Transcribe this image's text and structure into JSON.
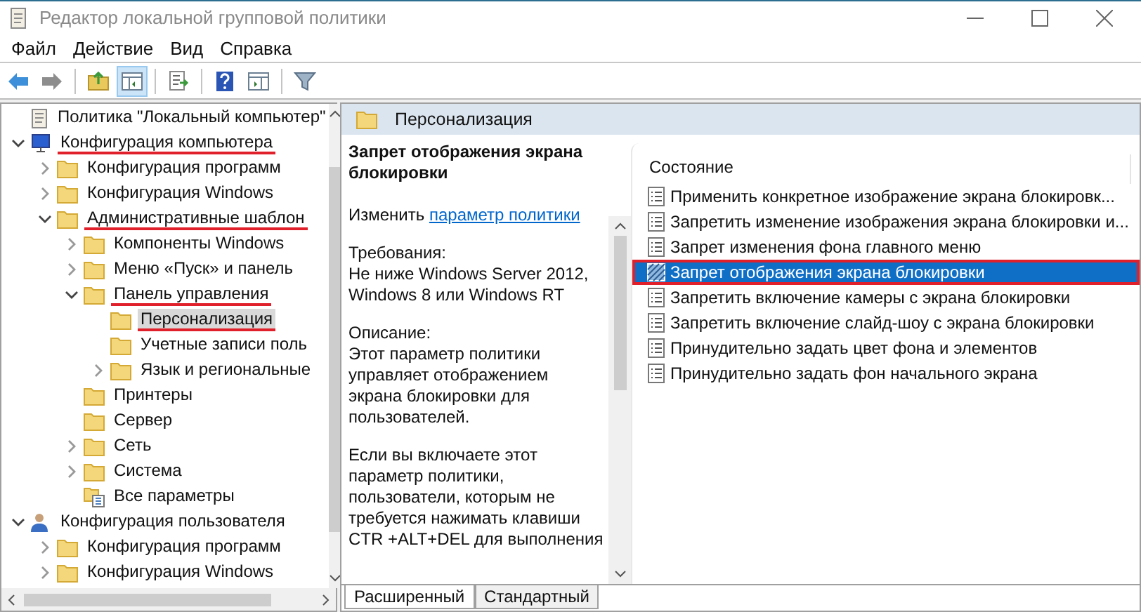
{
  "window": {
    "title": "Редактор локальной групповой политики"
  },
  "menu": [
    "Файл",
    "Действие",
    "Вид",
    "Справка"
  ],
  "toolbar": [
    [
      {
        "kind": "back",
        "pressed": false
      },
      {
        "kind": "forward",
        "pressed": false
      }
    ],
    [
      {
        "kind": "up",
        "pressed": false
      },
      {
        "kind": "tree-toggle",
        "pressed": true
      }
    ],
    [
      {
        "kind": "export",
        "pressed": false
      }
    ],
    [
      {
        "kind": "help",
        "pressed": false
      },
      {
        "kind": "properties",
        "pressed": false
      }
    ],
    [
      {
        "kind": "filter",
        "pressed": false
      }
    ]
  ],
  "tree": [
    {
      "label": "Политика \"Локальный компьютер\"",
      "kind": "policy",
      "selected": false,
      "underlined": false,
      "children": [
        {
          "label": "Конфигурация компьютера",
          "kind": "computer",
          "expanded": true,
          "selected": false,
          "underlined": true,
          "children": [
            {
              "label": "Конфигурация программ",
              "kind": "folder",
              "expanded": false,
              "selected": false,
              "underlined": false
            },
            {
              "label": "Конфигурация Windows",
              "kind": "folder",
              "expanded": false,
              "selected": false,
              "underlined": false
            },
            {
              "label": "Административные шаблон",
              "kind": "folder",
              "expanded": true,
              "selected": false,
              "underlined": true,
              "children": [
                {
                  "label": "Компоненты Windows",
                  "kind": "folder",
                  "expanded": false,
                  "selected": false,
                  "underlined": false
                },
                {
                  "label": "Меню «Пуск» и панель",
                  "kind": "folder",
                  "expanded": false,
                  "selected": false,
                  "underlined": false
                },
                {
                  "label": "Панель управления",
                  "kind": "folder",
                  "expanded": true,
                  "selected": false,
                  "underlined": true,
                  "children": [
                    {
                      "label": "Персонализация",
                      "kind": "folder",
                      "selected": true,
                      "underlined": true
                    },
                    {
                      "label": "Учетные записи поль",
                      "kind": "folder",
                      "selected": false,
                      "underlined": false
                    },
                    {
                      "label": "Язык и региональные",
                      "kind": "folder",
                      "expanded": false,
                      "selected": false,
                      "underlined": false
                    }
                  ]
                },
                {
                  "label": "Принтеры",
                  "kind": "folder",
                  "selected": false,
                  "underlined": false
                },
                {
                  "label": "Сервер",
                  "kind": "folder",
                  "selected": false,
                  "underlined": false
                },
                {
                  "label": "Сеть",
                  "kind": "folder",
                  "expanded": false,
                  "selected": false,
                  "underlined": false
                },
                {
                  "label": "Система",
                  "kind": "folder",
                  "expanded": false,
                  "selected": false,
                  "underlined": false
                },
                {
                  "label": "Все параметры",
                  "kind": "all-settings",
                  "selected": false,
                  "underlined": false
                }
              ]
            }
          ]
        },
        {
          "label": "Конфигурация пользователя",
          "kind": "user",
          "expanded": true,
          "selected": false,
          "underlined": false,
          "children": [
            {
              "label": "Конфигурация программ",
              "kind": "folder",
              "expanded": false,
              "selected": false,
              "underlined": false
            },
            {
              "label": "Конфигурация Windows",
              "kind": "folder",
              "expanded": false,
              "selected": false,
              "underlined": false
            }
          ]
        }
      ]
    }
  ],
  "details": {
    "header": "Персонализация",
    "title": "Запрет отображения экрана блокировки",
    "edit_prefix": "Изменить",
    "edit_link": "параметр политики",
    "paragraphs": [
      [
        "Требования:",
        "Не ниже Windows Server 2012,",
        "Windows 8 или Windows RT"
      ],
      [
        "Описание:",
        "Этот параметр политики",
        "управляет отображением",
        "экрана блокировки для",
        "пользователей."
      ],
      [
        "Если вы включаете этот",
        "параметр политики,",
        "пользователи, которым не",
        "требуется нажимать клавиши",
        "CTR +ALT+DEL для выполнения"
      ]
    ]
  },
  "settings": {
    "column": "Состояние",
    "items": [
      {
        "label": "Применить конкретное изображение экрана блокировк...",
        "selected": false,
        "outlined": false
      },
      {
        "label": "Запретить изменение изображения экрана блокировки и...",
        "selected": false,
        "outlined": false
      },
      {
        "label": "Запрет изменения фона главного меню",
        "selected": false,
        "outlined": false
      },
      {
        "label": "Запрет отображения экрана блокировки",
        "selected": true,
        "outlined": true
      },
      {
        "label": "Запретить включение камеры с экрана блокировки",
        "selected": false,
        "outlined": false
      },
      {
        "label": "Запретить включение слайд-шоу с экрана блокировки",
        "selected": false,
        "outlined": false
      },
      {
        "label": "Принудительно задать цвет фона и элементов",
        "selected": false,
        "outlined": false
      },
      {
        "label": "Принудительно задать фон начального экрана",
        "selected": false,
        "outlined": false
      }
    ]
  },
  "tabs": [
    {
      "label": "Расширенный",
      "selected": true
    },
    {
      "label": "Стандартный",
      "selected": false
    }
  ]
}
